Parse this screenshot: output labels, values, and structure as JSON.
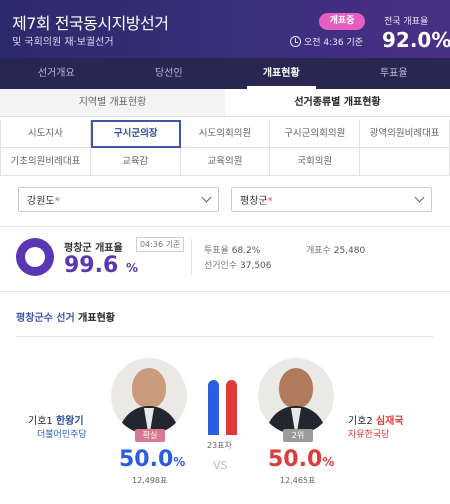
{
  "header": {
    "title": "제7회 전국동시지방선거",
    "subtitle": "및 국회의원 재·보궐선거",
    "badge": "개표중",
    "time": "오전 4:36 기준",
    "rate_label": "전국 개표율",
    "rate_value": "92.0%"
  },
  "nav": [
    "선거개요",
    "당선인",
    "개표현황",
    "투표율"
  ],
  "subtabs": [
    "지역별 개표현황",
    "선거종류별 개표현황"
  ],
  "grid": [
    "시도지사",
    "구시군의장",
    "시도의회의원",
    "구시군의회의원",
    "광역의원비례대표",
    "기초의원비례대표",
    "교육감",
    "교육의원",
    "국회의원",
    ""
  ],
  "selects": {
    "province": "강원도",
    "county": "평창군"
  },
  "rate": {
    "label": "평창군 개표율",
    "time": "04:36 기준",
    "value": "99.6",
    "unit": "%",
    "turnout_label": "투표율",
    "turnout": "68.2%",
    "voters_label": "선거인수",
    "voters": "37,506",
    "counted_label": "개표수",
    "counted": "25,480"
  },
  "section": {
    "title_blue": "평창군수 선거",
    "title_dark": "개표현황"
  },
  "candidates": [
    {
      "num": "기호1",
      "name": "한왕기",
      "party": "더불어민주당",
      "tag": "확실",
      "pct": "50.0",
      "unit": "%",
      "votes": "12,498표",
      "party_color": "#2a5de0",
      "tag_color": "#d7798f"
    },
    {
      "num": "기호2",
      "name": "심재국",
      "party": "자유한국당",
      "tag": "2위",
      "pct": "50.0",
      "unit": "%",
      "votes": "12,465표",
      "party_color": "#e03a3a",
      "tag_color": "#9b9b9b"
    }
  ],
  "versus": {
    "diff": "23표차",
    "vs": "VS"
  },
  "colors": {
    "header": "#2b2a6b",
    "nav": "#282752",
    "accent_purple": "#5a36b5",
    "blue": "#2a5de0",
    "red": "#e03a3a"
  }
}
